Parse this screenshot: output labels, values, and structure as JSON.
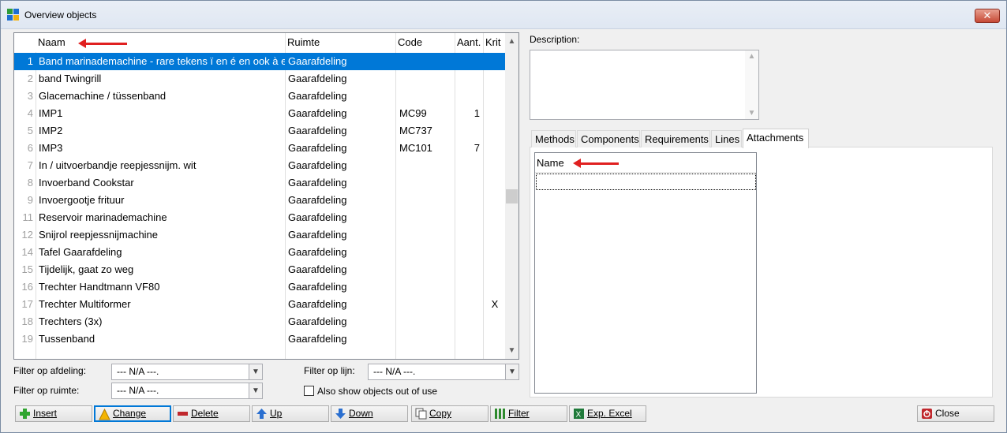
{
  "window": {
    "title": "Overview objects",
    "close_glyph": "✕"
  },
  "grid": {
    "columns": [
      "Naam",
      "Ruimte",
      "Code",
      "Aant.",
      "Krit"
    ],
    "rows": [
      {
        "n": "1",
        "naam": "Band marinademachine - rare tekens ï en é en ook à e",
        "ruimte": "Gaarafdeling",
        "code": "",
        "aant": "",
        "krit": ""
      },
      {
        "n": "2",
        "naam": "band Twingrill",
        "ruimte": "Gaarafdeling",
        "code": "",
        "aant": "",
        "krit": ""
      },
      {
        "n": "3",
        "naam": "Glacemachine / tüssenband",
        "ruimte": "Gaarafdeling",
        "code": "",
        "aant": "",
        "krit": ""
      },
      {
        "n": "4",
        "naam": "IMP1",
        "ruimte": "Gaarafdeling",
        "code": "MC99",
        "aant": "1",
        "krit": ""
      },
      {
        "n": "5",
        "naam": "IMP2",
        "ruimte": "Gaarafdeling",
        "code": "MC737",
        "aant": "",
        "krit": ""
      },
      {
        "n": "6",
        "naam": "IMP3",
        "ruimte": "Gaarafdeling",
        "code": "MC101",
        "aant": "7",
        "krit": ""
      },
      {
        "n": "7",
        "naam": "In / uitvoerbandje reepjessnijm. wit",
        "ruimte": "Gaarafdeling",
        "code": "",
        "aant": "",
        "krit": ""
      },
      {
        "n": "8",
        "naam": "Invoerband Cookstar",
        "ruimte": "Gaarafdeling",
        "code": "",
        "aant": "",
        "krit": ""
      },
      {
        "n": "9",
        "naam": "Invoergootje frituur",
        "ruimte": "Gaarafdeling",
        "code": "",
        "aant": "",
        "krit": ""
      },
      {
        "n": "11",
        "naam": "Reservoir marinademachine",
        "ruimte": "Gaarafdeling",
        "code": "",
        "aant": "",
        "krit": ""
      },
      {
        "n": "12",
        "naam": "Snijrol reepjessnijmachine",
        "ruimte": "Gaarafdeling",
        "code": "",
        "aant": "",
        "krit": ""
      },
      {
        "n": "14",
        "naam": "Tafel Gaarafdeling",
        "ruimte": "Gaarafdeling",
        "code": "",
        "aant": "",
        "krit": ""
      },
      {
        "n": "15",
        "naam": "Tijdelijk, gaat zo weg",
        "ruimte": "Gaarafdeling",
        "code": "",
        "aant": "",
        "krit": ""
      },
      {
        "n": "16",
        "naam": "Trechter Handtmann VF80",
        "ruimte": "Gaarafdeling",
        "code": "",
        "aant": "",
        "krit": ""
      },
      {
        "n": "17",
        "naam": "Trechter Multiformer",
        "ruimte": "Gaarafdeling",
        "code": "",
        "aant": "",
        "krit": "X"
      },
      {
        "n": "18",
        "naam": "Trechters (3x)",
        "ruimte": "Gaarafdeling",
        "code": "",
        "aant": "",
        "krit": ""
      },
      {
        "n": "19",
        "naam": "Tussenband",
        "ruimte": "Gaarafdeling",
        "code": "",
        "aant": "",
        "krit": ""
      }
    ]
  },
  "filters": {
    "afdeling_label": "Filter op afdeling:",
    "afdeling_value": "--- N/A ---.",
    "ruimte_label": "Filter op ruimte:",
    "ruimte_value": "--- N/A ---.",
    "lijn_label": "Filter op lijn:",
    "lijn_value": "--- N/A ---.",
    "also_show_label": "Also show objects out of use"
  },
  "right": {
    "description_label": "Description:",
    "tabs": [
      "Methods",
      "Components",
      "Requirements",
      "Lines",
      "Attachments"
    ],
    "attachments_column": "Name"
  },
  "buttons": {
    "insert": "Insert",
    "change": "Change",
    "delete": "Delete",
    "up": "Up",
    "down": "Down",
    "copy": "Copy",
    "filter": "Filter",
    "excel": "Exp. Excel",
    "close": "Close"
  },
  "colors": {
    "selection": "#0078d7",
    "annotation_arrow": "#e02020"
  }
}
